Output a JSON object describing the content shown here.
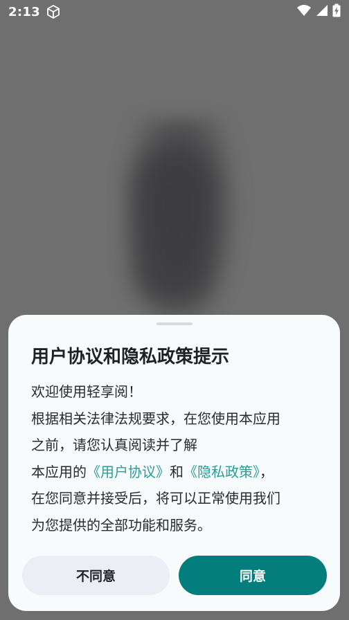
{
  "status_bar": {
    "time": "2:13"
  },
  "dialog": {
    "title": "用户协议和隐私政策提示",
    "line1": "欢迎使用轻享阅！",
    "line2": "根据相关法律法规要求，在您使用本应用",
    "line3": "之前，请您认真阅读并了解",
    "line4_prefix": "本应用的",
    "user_agreement_link": "《用户协议》",
    "line4_and": "和",
    "privacy_policy_link": "《隐私政策》",
    "line4_suffix": "，",
    "line5": "在您同意并接受后，将可以正常使用我们",
    "line6": "为您提供的全部功能和服务。",
    "disagree_label": "不同意",
    "agree_label": "同意"
  },
  "colors": {
    "accent": "#047d7d",
    "link": "#2e9a9a",
    "scrim": "#6f6f6f"
  }
}
